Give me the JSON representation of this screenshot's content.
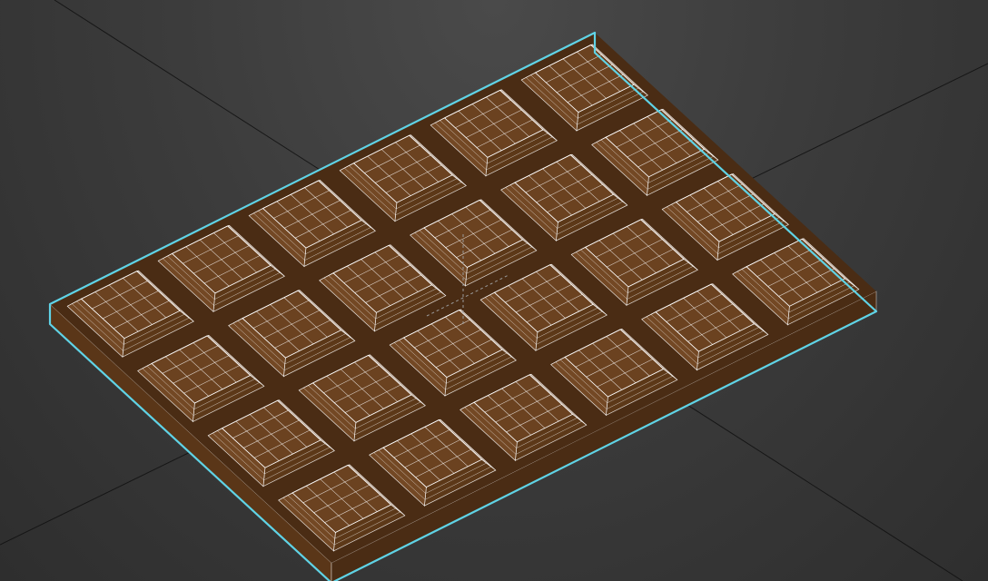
{
  "viewport": {
    "background": "#3c3c3c",
    "grid_line_color": "#111111"
  },
  "model": {
    "object": "chocolate-bar",
    "rows": 4,
    "cols": 6,
    "chocolate_color": "#6b4220",
    "chocolate_dark": "#4a2c14",
    "chocolate_side": "#5a3618",
    "wireframe_color": "#ffffff",
    "selection_outline_color": "#5fd3e6"
  }
}
